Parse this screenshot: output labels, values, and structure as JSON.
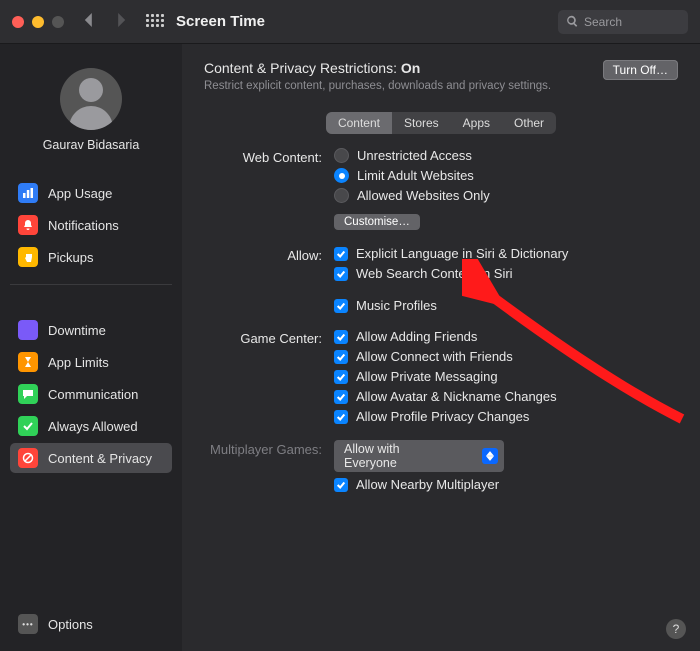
{
  "titlebar": {
    "title": "Screen Time",
    "search_placeholder": "Search"
  },
  "sidebar": {
    "username": "Gaurav Bidasaria",
    "group1": [
      {
        "label": "App Usage",
        "color": "#2f7cf6",
        "icon": "bars"
      },
      {
        "label": "Notifications",
        "color": "#ff453a",
        "icon": "bell"
      },
      {
        "label": "Pickups",
        "color": "#ffb800",
        "icon": "hand"
      }
    ],
    "group2": [
      {
        "label": "Downtime",
        "color": "#7a5af8",
        "icon": "moon"
      },
      {
        "label": "App Limits",
        "color": "#ff9500",
        "icon": "hourglass"
      },
      {
        "label": "Communication",
        "color": "#30d158",
        "icon": "bubble"
      },
      {
        "label": "Always Allowed",
        "color": "#30d158",
        "icon": "check"
      },
      {
        "label": "Content & Privacy",
        "color": "#ff453a",
        "icon": "nosign",
        "selected": true
      }
    ],
    "options_label": "Options"
  },
  "main": {
    "heading_prefix": "Content & Privacy Restrictions: ",
    "heading_state": "On",
    "subheading": "Restrict explicit content, purchases, downloads and privacy settings.",
    "turn_off_label": "Turn Off…",
    "tabs": [
      "Content",
      "Stores",
      "Apps",
      "Other"
    ],
    "active_tab": 0,
    "web_content_label": "Web Content:",
    "web_options": [
      "Unrestricted Access",
      "Limit Adult Websites",
      "Allowed Websites Only"
    ],
    "web_selected": 1,
    "customise_label": "Customise…",
    "allow_label": "Allow:",
    "allow_items": [
      "Explicit Language in Siri & Dictionary",
      "Web Search Content in Siri",
      "Music Profiles"
    ],
    "gamecenter_label": "Game Center:",
    "gamecenter_items": [
      "Allow Adding Friends",
      "Allow Connect with Friends",
      "Allow Private Messaging",
      "Allow Avatar & Nickname Changes",
      "Allow Profile Privacy Changes"
    ],
    "multiplayer_label": "Multiplayer Games:",
    "multiplayer_value": "Allow with Everyone",
    "nearby_label": "Allow Nearby Multiplayer"
  }
}
